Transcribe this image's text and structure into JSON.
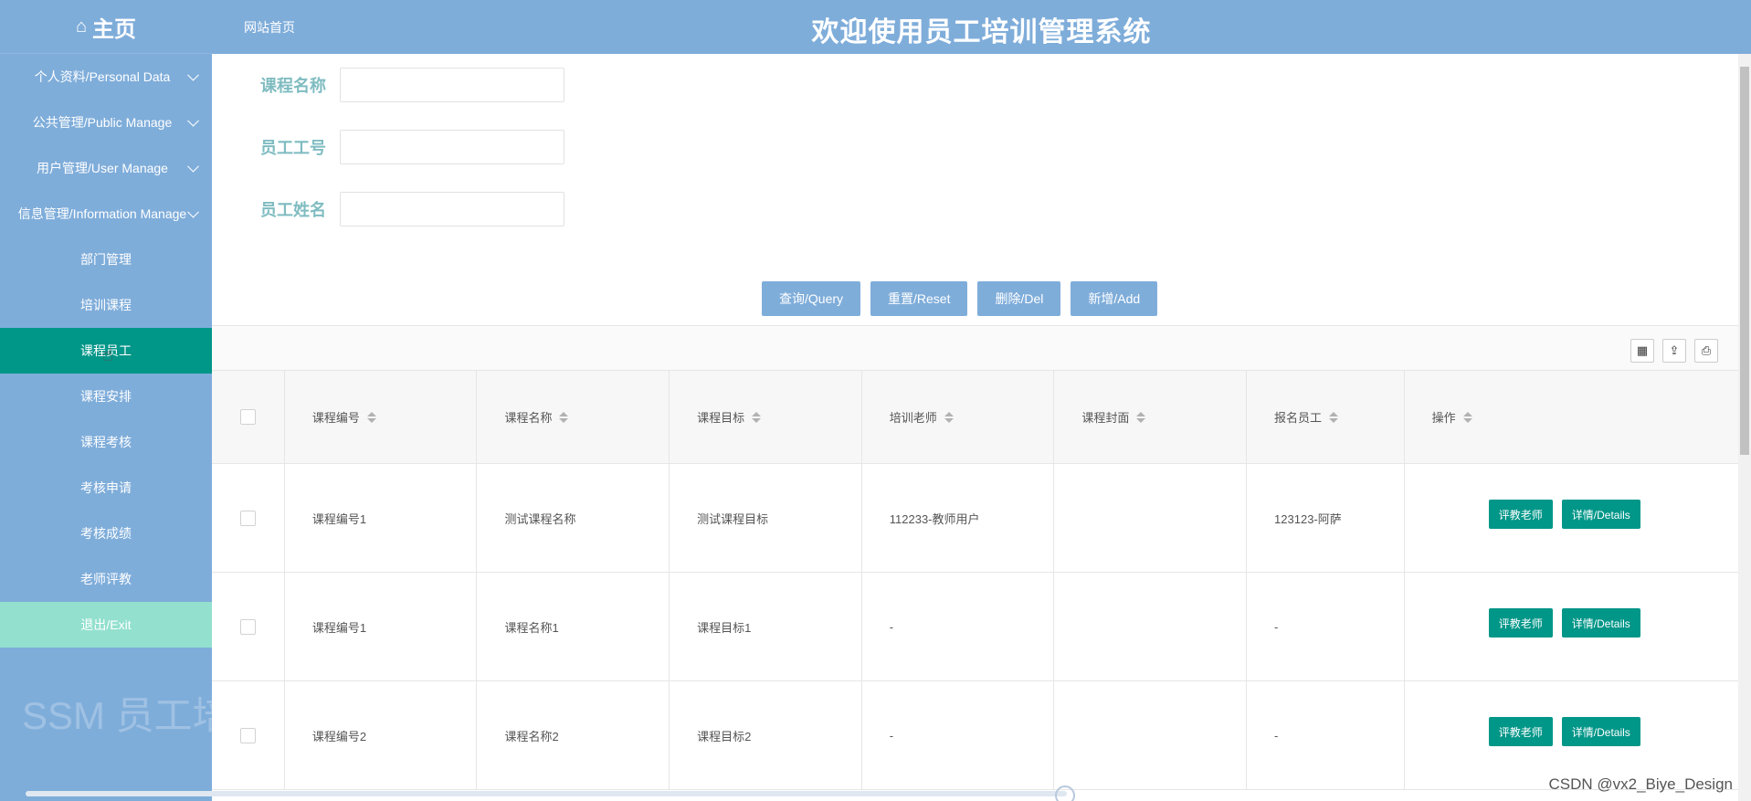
{
  "sidebar": {
    "brand": "主页",
    "items": [
      {
        "label": "个人资料/Personal Data",
        "type": "parent"
      },
      {
        "label": "公共管理/Public Manage",
        "type": "parent"
      },
      {
        "label": "用户管理/User Manage",
        "type": "parent"
      },
      {
        "label": "信息管理/Information Manage",
        "type": "parent"
      },
      {
        "label": "部门管理",
        "type": "child"
      },
      {
        "label": "培训课程",
        "type": "child"
      },
      {
        "label": "课程员工",
        "type": "active"
      },
      {
        "label": "课程安排",
        "type": "child"
      },
      {
        "label": "课程考核",
        "type": "child"
      },
      {
        "label": "考核申请",
        "type": "child"
      },
      {
        "label": "考核成绩",
        "type": "child"
      },
      {
        "label": "老师评教",
        "type": "child"
      },
      {
        "label": "退出/Exit",
        "type": "exit"
      }
    ],
    "watermark": "SSM 员工培"
  },
  "header": {
    "link": "网站首页",
    "title": "欢迎使用员工培训管理系统"
  },
  "search": {
    "fields": [
      {
        "label": "课程名称",
        "value": ""
      },
      {
        "label": "员工工号",
        "value": ""
      },
      {
        "label": "员工姓名",
        "value": ""
      }
    ],
    "buttons": [
      "查询/Query",
      "重置/Reset",
      "删除/Del",
      "新增/Add"
    ]
  },
  "table": {
    "columns": [
      "课程编号",
      "课程名称",
      "课程目标",
      "培训老师",
      "课程封面",
      "报名员工",
      "操作"
    ],
    "rows": [
      [
        "课程编号1",
        "测试课程名称",
        "测试课程目标",
        "112233-教师用户",
        "",
        "123123-阿萨"
      ],
      [
        "课程编号1",
        "课程名称1",
        "课程目标1",
        "-",
        "",
        "-"
      ],
      [
        "课程编号2",
        "课程名称2",
        "课程目标2",
        "-",
        "",
        "-"
      ]
    ],
    "row_actions": [
      "评教老师",
      "详情/Details"
    ]
  },
  "footer": "CSDN @vx2_Biye_Design",
  "colors": {
    "primary": "#7fadda",
    "active": "#009688",
    "exit": "#93e0cf",
    "label": "#7fbcc1"
  }
}
